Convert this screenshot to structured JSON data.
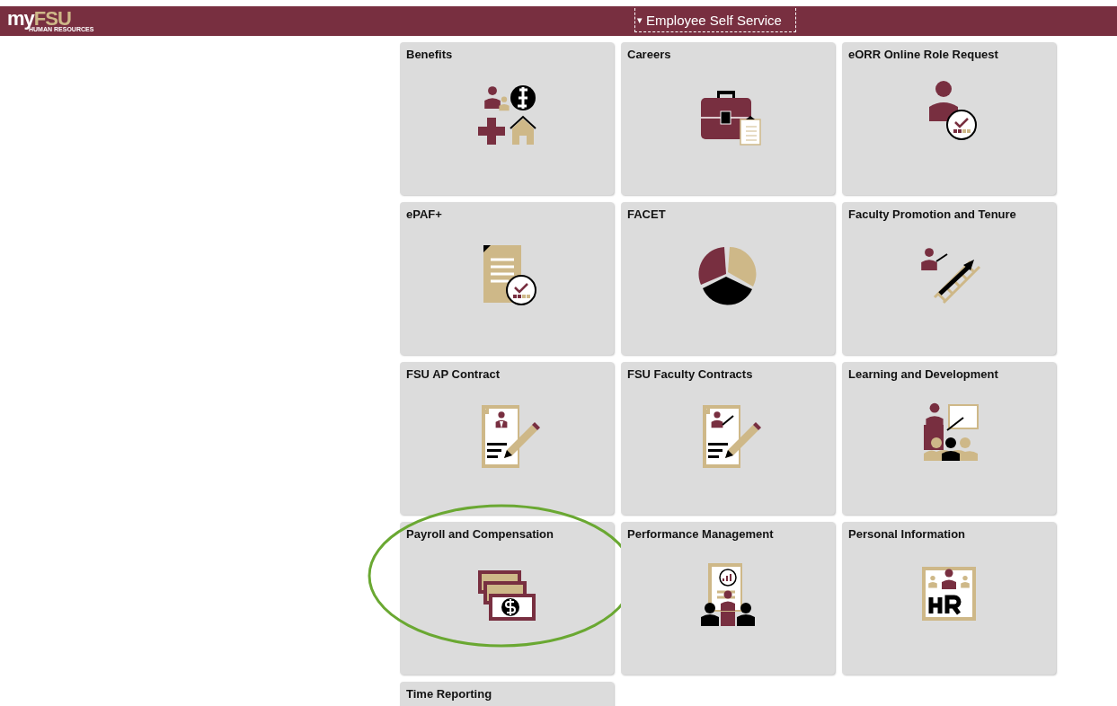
{
  "header": {
    "logo": {
      "prefix": "my",
      "brand": "FSU",
      "subtitle": "HUMAN RESOURCES"
    },
    "menu": {
      "label": "Employee Self Service",
      "caret": "▾"
    }
  },
  "tiles": [
    {
      "title": "Benefits",
      "circled": false
    },
    {
      "title": "Careers",
      "circled": false
    },
    {
      "title": "eORR Online Role Request",
      "circled": false
    },
    {
      "title": "ePAF+",
      "circled": false
    },
    {
      "title": "FACET",
      "circled": false
    },
    {
      "title": "Faculty Promotion and Tenure",
      "circled": false
    },
    {
      "title": "FSU AP Contract",
      "circled": false
    },
    {
      "title": "FSU Faculty Contracts",
      "circled": false
    },
    {
      "title": "Learning and Development",
      "circled": false
    },
    {
      "title": "Payroll and Compensation",
      "circled": true
    },
    {
      "title": "Performance Management",
      "circled": false
    },
    {
      "title": "Personal Information",
      "circled": false
    },
    {
      "title": "Time Reporting",
      "circled": false
    }
  ]
}
